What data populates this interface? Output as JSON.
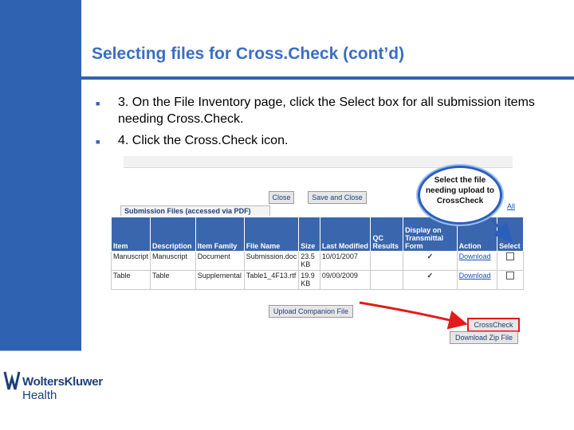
{
  "slide": {
    "title": "Selecting files for Cross.Check (cont’d)",
    "bullets": [
      "3. On the File Inventory page, click the Select box for all submission items needing Cross.Check.",
      "4. Click the Cross.Check icon."
    ]
  },
  "logo": {
    "brand": "WoltersKluwer",
    "sub": "Health"
  },
  "screenshot": {
    "buttons": {
      "close": "Close",
      "save_close": "Save and Close",
      "upload_companion": "Upload Companion File",
      "crosscheck": "CrossCheck",
      "download_zip": "Download Zip File"
    },
    "tab_label": "Submission Files (accessed via PDF)",
    "all_link": "All",
    "callout": "Select the file needing upload to CrossCheck",
    "columns": [
      "Item",
      "Description",
      "Item Family",
      "File Name",
      "Size",
      "Last Modified",
      "QC Results",
      "Display on Transmittal Form",
      "Action",
      "Select"
    ],
    "rows": [
      {
        "item": "Manuscript",
        "description": "Manuscript",
        "family": "Document",
        "file": "Submission.doc",
        "size": "23.5 KB",
        "modified": "10/01/2007",
        "qc": "",
        "display": "✓",
        "action": "Download"
      },
      {
        "item": "Table",
        "description": "Table",
        "family": "Supplemental",
        "file": "Table1_4F13.rtf",
        "size": "19.9 KB",
        "modified": "09/00/2009",
        "qc": "",
        "display": "✓",
        "action": "Download"
      }
    ]
  },
  "colors": {
    "brand_blue": "#2f62b1",
    "title_blue": "#3a6ec2",
    "header_blue": "#3a66ad",
    "arrow_red": "#e21b1b"
  }
}
